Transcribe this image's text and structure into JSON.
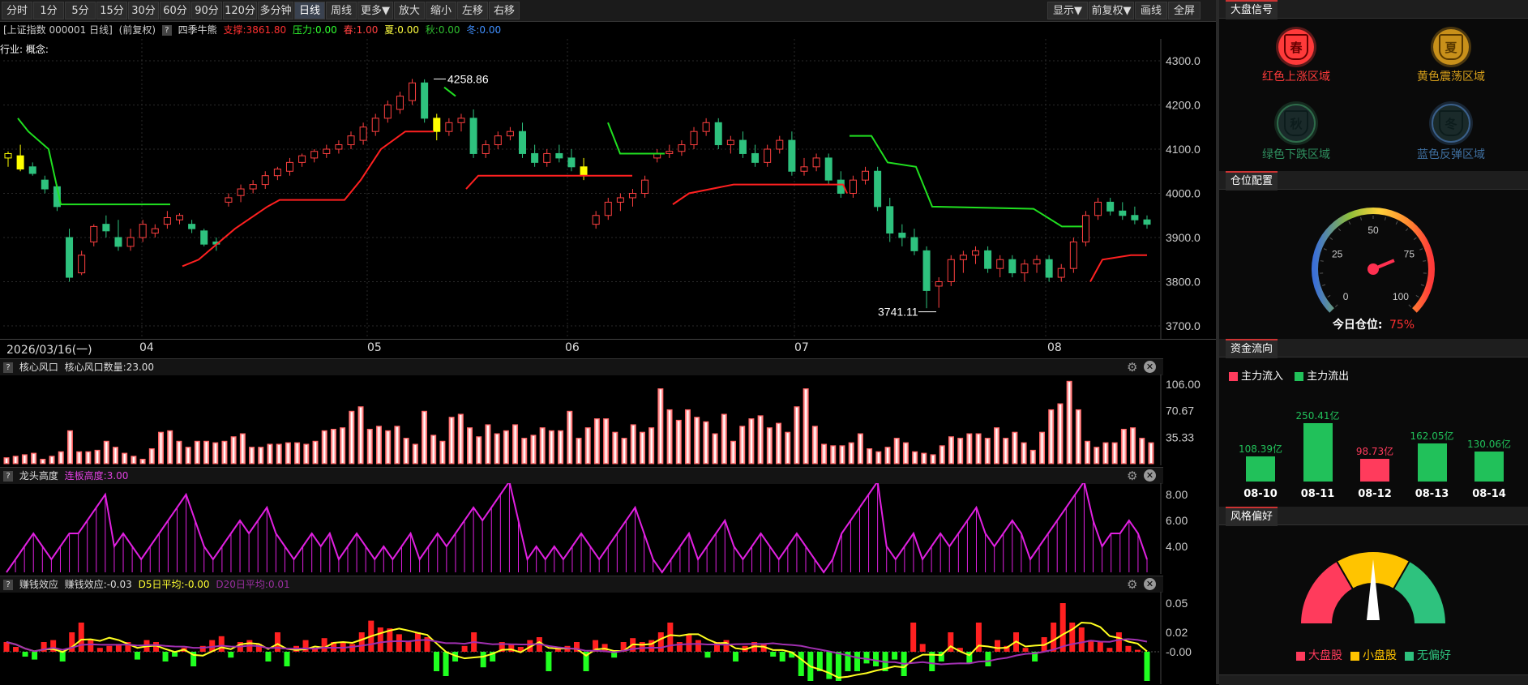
{
  "toolbar": {
    "periods": [
      "分时",
      "1分",
      "5分",
      "15分",
      "30分",
      "60分",
      "90分",
      "120分",
      "多分钟",
      "日线",
      "周线",
      "更多▼",
      "放大",
      "缩小",
      "左移",
      "右移"
    ],
    "active": "日线",
    "right_buttons": [
      "显示▼",
      "前复权▼",
      "画线",
      "全屏"
    ]
  },
  "chart": {
    "title": "[上证指数 000001 日线]",
    "adjust": "(前复权)",
    "indicator": "四季牛熊",
    "support": "支撑:3861.80",
    "pressure": "压力:0.00",
    "spring": "春:1.00",
    "summer": "夏:0.00",
    "autumn": "秋:0.00",
    "winter": "冬:0.00",
    "industry": "行业: 概念:",
    "high_label": "4258.86",
    "low_label": "3741.11",
    "y_ticks": [
      "4300.0",
      "4200.0",
      "4100.0",
      "4000.0",
      "3900.0",
      "3800.0",
      "3700.0"
    ],
    "date_label": "2026/03/16(一)",
    "months": [
      "04",
      "05",
      "06",
      "07",
      "08"
    ]
  },
  "panel1": {
    "title": "核心风口",
    "value_text": "核心风口数量:23.00",
    "y_ticks": [
      "106.00",
      "70.67",
      "35.33"
    ]
  },
  "panel2": {
    "title": "龙头高度",
    "value_text": "连板高度:3.00",
    "y_ticks": [
      "8.00",
      "6.00",
      "4.00"
    ]
  },
  "panel3": {
    "title": "赚钱效应",
    "value_text": "赚钱效应:-0.03",
    "d5": "D5日平均:-0.00",
    "d20": "D20日平均:0.01",
    "y_ticks": [
      "0.05",
      "0.02",
      "-0.00"
    ]
  },
  "right": {
    "sec1_title": "大盘信号",
    "seasons": [
      {
        "char": "春",
        "label": "红色上涨区域",
        "color": "#ff3a3a"
      },
      {
        "char": "夏",
        "label": "黄色震荡区域",
        "color": "#c8901a"
      },
      {
        "char": "秋",
        "label": "绿色下跌区域",
        "color": "#2e6b4a"
      },
      {
        "char": "冬",
        "label": "蓝色反弹区域",
        "color": "#3a5f8a"
      }
    ],
    "sec2_title": "仓位配置",
    "gauge_ticks": [
      "0",
      "25",
      "50",
      "75",
      "100"
    ],
    "position_label": "今日仓位:",
    "position_value": "75%",
    "sec3_title": "资金流向",
    "inflow_label": "主力流入",
    "outflow_label": "主力流出",
    "flows": [
      {
        "date": "08-10",
        "value": "108.39亿",
        "dir": "out",
        "amount": 108.39
      },
      {
        "date": "08-11",
        "value": "250.41亿",
        "dir": "out",
        "amount": 250.41
      },
      {
        "date": "08-12",
        "value": "98.73亿",
        "dir": "in",
        "amount": 98.73
      },
      {
        "date": "08-13",
        "value": "162.05亿",
        "dir": "out",
        "amount": 162.05
      },
      {
        "date": "08-14",
        "value": "130.06亿",
        "dir": "out",
        "amount": 130.06
      }
    ],
    "sec4_title": "风格偏好",
    "style_legend": [
      {
        "label": "大盘股",
        "color": "#ff3b5c"
      },
      {
        "label": "小盘股",
        "color": "#ffc400"
      },
      {
        "label": "无偏好",
        "color": "#2ec27e"
      }
    ]
  },
  "chart_data": {
    "type": "candlestick",
    "price_range": [
      3700,
      4300
    ],
    "candles": [
      [
        4080,
        4095,
        4060,
        4090
      ],
      [
        4085,
        4110,
        4050,
        4055
      ],
      [
        4060,
        4070,
        4040,
        4045
      ],
      [
        4030,
        4040,
        4000,
        4010
      ],
      [
        4015,
        4020,
        3960,
        3970
      ],
      [
        3900,
        3920,
        3800,
        3810
      ],
      [
        3820,
        3870,
        3815,
        3860
      ],
      [
        3890,
        3930,
        3880,
        3925
      ],
      [
        3930,
        3950,
        3900,
        3915
      ],
      [
        3900,
        3940,
        3870,
        3880
      ],
      [
        3880,
        3920,
        3870,
        3900
      ],
      [
        3900,
        3940,
        3890,
        3930
      ],
      [
        3910,
        3930,
        3900,
        3920
      ],
      [
        3930,
        3960,
        3920,
        3945
      ],
      [
        3940,
        3955,
        3930,
        3950
      ],
      [
        3930,
        3940,
        3910,
        3920
      ],
      [
        3915,
        3920,
        3880,
        3885
      ],
      [
        3890,
        3900,
        3870,
        3885
      ],
      [
        3980,
        4000,
        3970,
        3990
      ],
      [
        3995,
        4020,
        3980,
        4010
      ],
      [
        4010,
        4030,
        4000,
        4020
      ],
      [
        4020,
        4050,
        4010,
        4040
      ],
      [
        4040,
        4060,
        4030,
        4055
      ],
      [
        4050,
        4080,
        4040,
        4070
      ],
      [
        4070,
        4090,
        4060,
        4085
      ],
      [
        4080,
        4100,
        4070,
        4095
      ],
      [
        4090,
        4110,
        4080,
        4100
      ],
      [
        4100,
        4120,
        4090,
        4110
      ],
      [
        4110,
        4140,
        4100,
        4130
      ],
      [
        4120,
        4160,
        4110,
        4150
      ],
      [
        4140,
        4180,
        4130,
        4170
      ],
      [
        4170,
        4210,
        4160,
        4200
      ],
      [
        4190,
        4230,
        4180,
        4220
      ],
      [
        4210,
        4259,
        4200,
        4250
      ],
      [
        4250,
        4258,
        4160,
        4170
      ],
      [
        4170,
        4180,
        4120,
        4140
      ],
      [
        4140,
        4170,
        4130,
        4160
      ],
      [
        4160,
        4180,
        4140,
        4170
      ],
      [
        4170,
        4190,
        4080,
        4090
      ],
      [
        4090,
        4120,
        4080,
        4110
      ],
      [
        4110,
        4140,
        4100,
        4130
      ],
      [
        4130,
        4150,
        4120,
        4140
      ],
      [
        4140,
        4160,
        4080,
        4090
      ],
      [
        4090,
        4110,
        4060,
        4070
      ],
      [
        4070,
        4100,
        4060,
        4090
      ],
      [
        4090,
        4110,
        4070,
        4080
      ],
      [
        4080,
        4100,
        4050,
        4060
      ],
      [
        4060,
        4080,
        4030,
        4040
      ],
      [
        3930,
        3960,
        3920,
        3950
      ],
      [
        3950,
        3990,
        3940,
        3980
      ],
      [
        3980,
        4000,
        3960,
        3990
      ],
      [
        3990,
        4010,
        3970,
        4000
      ],
      [
        4000,
        4040,
        3990,
        4030
      ],
      [
        4080,
        4100,
        4070,
        4090
      ],
      [
        4090,
        4110,
        4080,
        4095
      ],
      [
        4095,
        4120,
        4085,
        4110
      ],
      [
        4110,
        4150,
        4100,
        4140
      ],
      [
        4140,
        4170,
        4130,
        4160
      ],
      [
        4160,
        4170,
        4100,
        4110
      ],
      [
        4110,
        4130,
        4090,
        4120
      ],
      [
        4120,
        4140,
        4080,
        4090
      ],
      [
        4090,
        4110,
        4060,
        4070
      ],
      [
        4070,
        4110,
        4060,
        4100
      ],
      [
        4100,
        4130,
        4090,
        4120
      ],
      [
        4120,
        4140,
        4040,
        4050
      ],
      [
        4050,
        4080,
        4040,
        4060
      ],
      [
        4060,
        4090,
        4050,
        4080
      ],
      [
        4080,
        4090,
        4020,
        4030
      ],
      [
        4030,
        4050,
        3990,
        4000
      ],
      [
        4000,
        4040,
        3990,
        4030
      ],
      [
        4030,
        4060,
        4020,
        4050
      ],
      [
        4050,
        4060,
        3960,
        3970
      ],
      [
        3970,
        3990,
        3890,
        3910
      ],
      [
        3910,
        3930,
        3880,
        3900
      ],
      [
        3900,
        3920,
        3860,
        3870
      ],
      [
        3870,
        3880,
        3740,
        3780
      ],
      [
        3790,
        3810,
        3741,
        3800
      ],
      [
        3800,
        3860,
        3790,
        3850
      ],
      [
        3850,
        3870,
        3820,
        3860
      ],
      [
        3860,
        3880,
        3840,
        3870
      ],
      [
        3870,
        3880,
        3820,
        3830
      ],
      [
        3830,
        3860,
        3810,
        3850
      ],
      [
        3850,
        3860,
        3810,
        3820
      ],
      [
        3820,
        3850,
        3800,
        3840
      ],
      [
        3840,
        3860,
        3820,
        3850
      ],
      [
        3850,
        3860,
        3800,
        3810
      ],
      [
        3810,
        3840,
        3800,
        3830
      ],
      [
        3830,
        3900,
        3820,
        3890
      ],
      [
        3890,
        3960,
        3880,
        3950
      ],
      [
        3950,
        3990,
        3940,
        3980
      ],
      [
        3980,
        3990,
        3950,
        3960
      ],
      [
        3960,
        3980,
        3940,
        3950
      ],
      [
        3950,
        3970,
        3930,
        3940
      ],
      [
        3940,
        3950,
        3920,
        3930
      ]
    ]
  }
}
